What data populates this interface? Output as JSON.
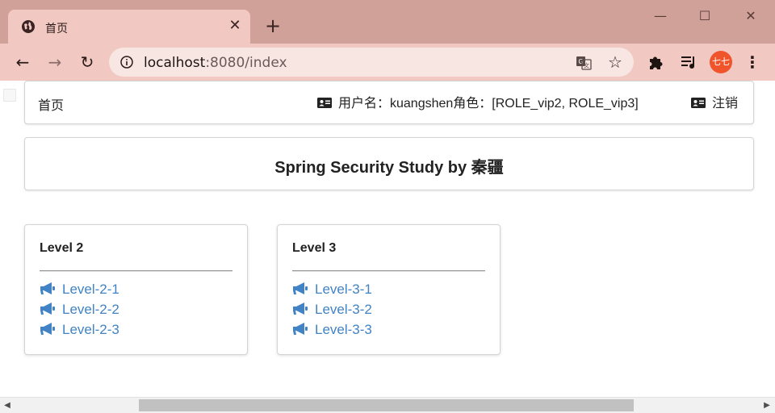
{
  "browser": {
    "tab_title": "首页",
    "tab_close": "✕",
    "new_tab": "+",
    "window": {
      "minimize": "—",
      "maximize": "☐",
      "close": "✕"
    },
    "nav": {
      "back": "←",
      "forward": "→",
      "reload": "↻"
    },
    "url_host": "localhost",
    "url_path": ":8080/index",
    "bookmark_star": "☆",
    "profile_initials": "七七",
    "menu": "⋮"
  },
  "top_menu": {
    "home": "首页",
    "user_info": "用户名：kuangshen角色：[ROLE_vip2, ROLE_vip3]",
    "logout": "注销"
  },
  "header": {
    "title": "Spring Security Study by 秦疆"
  },
  "cards": [
    {
      "title": "Level 2",
      "links": [
        "Level-2-1",
        "Level-2-2",
        "Level-2-3"
      ]
    },
    {
      "title": "Level 3",
      "links": [
        "Level-3-1",
        "Level-3-2",
        "Level-3-3"
      ]
    }
  ],
  "scrollbar": {
    "left_arrow": "◀",
    "right_arrow": "▶"
  },
  "colors": {
    "link": "#4183c4",
    "tab_active": "#f1c8c2",
    "tabstrip": "#cfa198",
    "avatar": "#f0542a"
  }
}
